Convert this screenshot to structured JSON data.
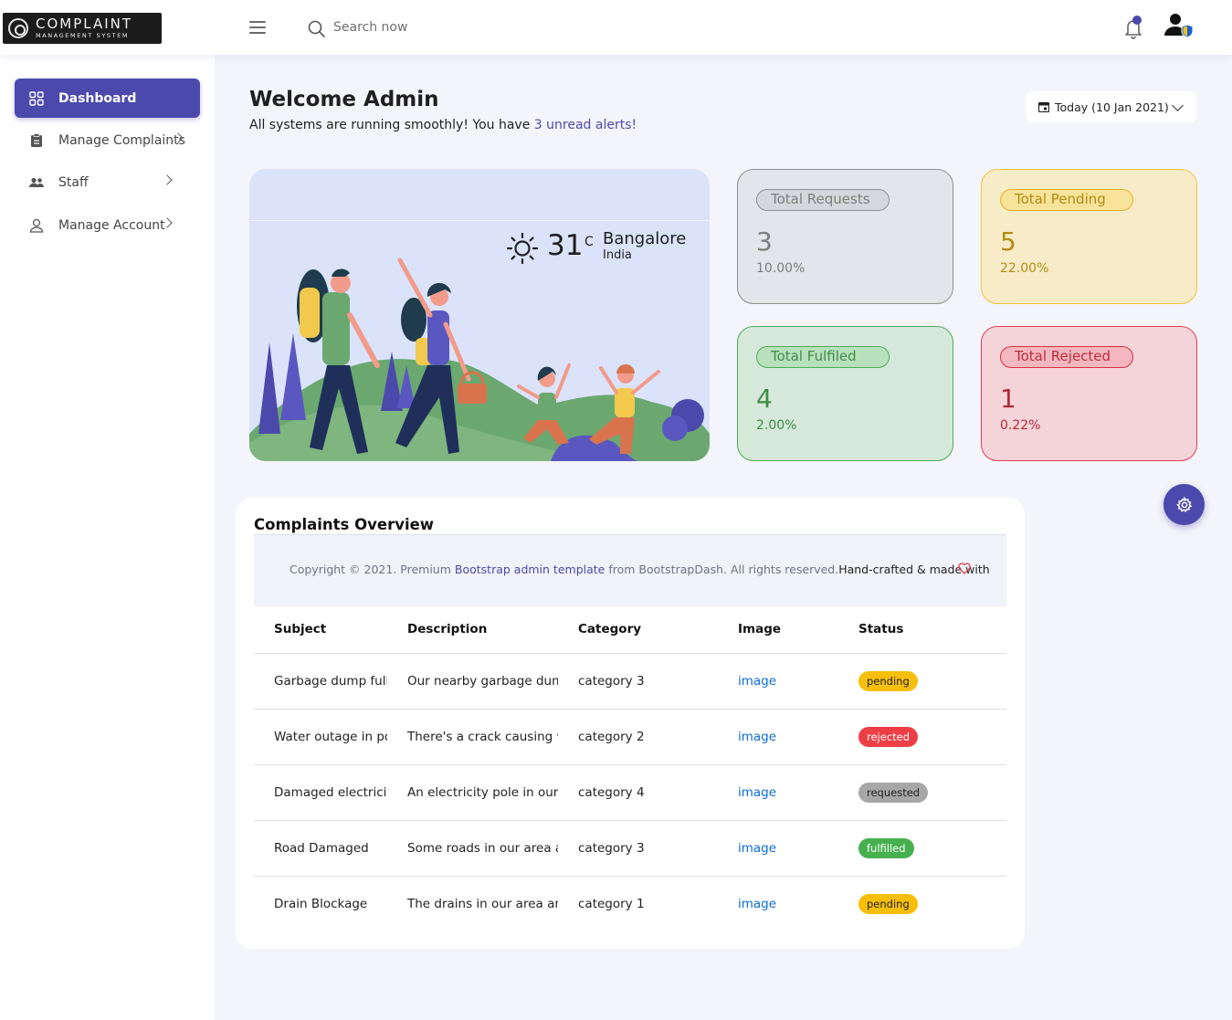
{
  "brand": {
    "title": "COMPLAINT",
    "subtitle": "MANAGEMENT SYSTEM"
  },
  "header": {
    "search_placeholder": "Search now",
    "icons": [
      "menu-icon",
      "search-icon",
      "bell-icon",
      "user-shield-icon"
    ],
    "accent_color": "#4b49ac"
  },
  "sidebar": {
    "items": [
      {
        "label": "Dashboard",
        "icon": "grid-icon",
        "active": true
      },
      {
        "label": "Manage Complaints",
        "icon": "clipboard-icon",
        "active": false
      },
      {
        "label": "Staff",
        "icon": "people-icon",
        "active": false
      },
      {
        "label": "Manage Account",
        "icon": "user-icon",
        "active": false
      }
    ]
  },
  "welcome": {
    "title": "Welcome Admin",
    "subtitle_prefix": "All systems are running smoothly! You have ",
    "alerts_link": "3 unread alerts!"
  },
  "date_filter": {
    "label": "Today (10 Jan 2021)"
  },
  "weather": {
    "temp": "31",
    "unit": "C",
    "city": "Bangalore",
    "country": "India"
  },
  "stats": {
    "requests": {
      "label": "Total Requests",
      "value": "3",
      "percent": "10.00%"
    },
    "pending": {
      "label": "Total Pending",
      "value": "5",
      "percent": "22.00%"
    },
    "fulfilled": {
      "label": "Total Fulfiled",
      "value": "4",
      "percent": "2.00%"
    },
    "rejected": {
      "label": "Total Rejected",
      "value": "1",
      "percent": "0.22%"
    }
  },
  "overview": {
    "title": "Complaints Overview",
    "footer": {
      "prefix": "Copyright © 2021. Premium ",
      "link": "Bootstrap admin template",
      "middle": " from BootstrapDash. All rights reserved.",
      "tail": "Hand-crafted & made with"
    },
    "columns": [
      "Subject",
      "Description",
      "Category",
      "Image",
      "Status"
    ],
    "rows": [
      {
        "subject": "Garbage dump full",
        "description": "Our nearby garbage dump",
        "category": "category 3",
        "image": "image",
        "status": "pending"
      },
      {
        "subject": "Water outage in por",
        "description": "There's a crack causing wa",
        "category": "category 2",
        "image": "image",
        "status": "rejected"
      },
      {
        "subject": "Damaged electricity",
        "description": "An electricity pole in our a",
        "category": "category 4",
        "image": "image",
        "status": "requested"
      },
      {
        "subject": "Road Damaged",
        "description": "Some roads in our area are",
        "category": "category 3",
        "image": "image",
        "status": "fulfilled"
      },
      {
        "subject": "Drain Blockage",
        "description": "The drains in our area are l",
        "category": "category 1",
        "image": "image",
        "status": "pending"
      }
    ]
  }
}
